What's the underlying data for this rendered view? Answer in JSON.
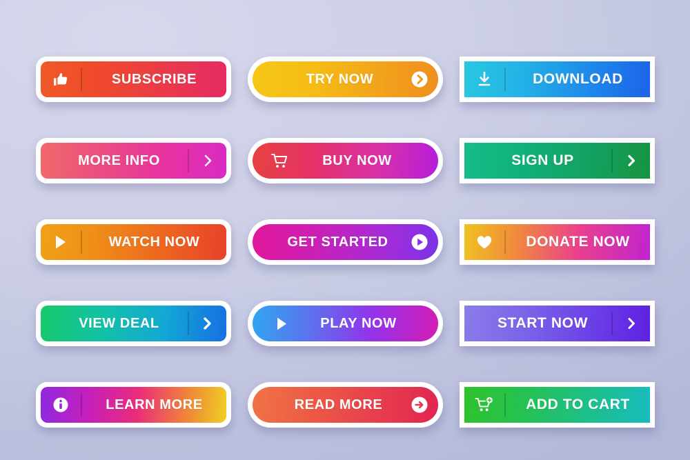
{
  "page": {
    "title": "Gradient Call-To-Action Button Set",
    "background_colors": [
      "#d6d8ec",
      "#b3b8d8"
    ],
    "columns": 3,
    "rows": 5,
    "button_count": 15
  },
  "buttons": [
    {
      "id": "subscribe",
      "label": "SUBSCRIBE",
      "shape": "rounded-rect",
      "icon": "thumbs-up-icon",
      "icon_position": "left",
      "divider": true,
      "gradient": [
        "#f05a28",
        "#e52a63"
      ]
    },
    {
      "id": "try-now",
      "label": "TRY NOW",
      "shape": "pill",
      "icon": "chevron-right-circle-icon",
      "icon_position": "right",
      "divider": false,
      "gradient": [
        "#f6c717",
        "#ef8f1f"
      ]
    },
    {
      "id": "download",
      "label": "DOWNLOAD",
      "shape": "square",
      "icon": "download-arrow-icon",
      "icon_position": "left",
      "divider": true,
      "gradient": [
        "#2ac7e0",
        "#1b63e8"
      ]
    },
    {
      "id": "more-info",
      "label": "MORE INFO",
      "shape": "rounded-rect",
      "icon": "chevron-right-icon",
      "icon_position": "right",
      "divider": true,
      "gradient": [
        "#ef6a6a",
        "#d92bc4"
      ]
    },
    {
      "id": "buy-now",
      "label": "BUY NOW",
      "shape": "pill",
      "icon": "shopping-cart-icon",
      "icon_position": "left",
      "divider": false,
      "gradient": [
        "#e8413f",
        "#b41ddb"
      ]
    },
    {
      "id": "sign-up",
      "label": "SIGN UP",
      "shape": "square",
      "icon": "chevron-right-icon",
      "icon_position": "right",
      "divider": true,
      "gradient": [
        "#14bd89",
        "#17943f"
      ]
    },
    {
      "id": "watch-now",
      "label": "WATCH NOW",
      "shape": "rounded-rect",
      "icon": "play-triangle-icon",
      "icon_position": "left",
      "divider": true,
      "gradient": [
        "#f0a118",
        "#e8412a"
      ]
    },
    {
      "id": "get-started",
      "label": "GET STARTED",
      "shape": "pill",
      "icon": "play-circle-icon",
      "icon_position": "right",
      "divider": false,
      "gradient": [
        "#e0189b",
        "#7a34e8"
      ]
    },
    {
      "id": "donate-now",
      "label": "DONATE NOW",
      "shape": "square",
      "icon": "heart-icon",
      "icon_position": "left",
      "divider": true,
      "gradient": [
        "#f0c222",
        "#c024cf"
      ]
    },
    {
      "id": "view-deal",
      "label": "VIEW DEAL",
      "shape": "rounded-rect",
      "icon": "chevron-right-icon",
      "icon_position": "right",
      "divider": true,
      "gradient": [
        "#17c96a",
        "#1670e2"
      ]
    },
    {
      "id": "play-now",
      "label": "PLAY NOW",
      "shape": "pill",
      "icon": "play-triangle-icon",
      "icon_position": "left",
      "divider": false,
      "gradient": [
        "#2fa6f0",
        "#d41cb4"
      ]
    },
    {
      "id": "start-now",
      "label": "START NOW",
      "shape": "square",
      "icon": "chevron-right-icon",
      "icon_position": "right",
      "divider": true,
      "gradient": [
        "#8a7ceb",
        "#5f21e0"
      ]
    },
    {
      "id": "learn-more",
      "label": "LEARN MORE",
      "shape": "rounded-rect",
      "icon": "info-circle-icon",
      "icon_position": "left",
      "divider": true,
      "gradient": [
        "#8e29e0",
        "#f0cf22"
      ]
    },
    {
      "id": "read-more",
      "label": "READ MORE",
      "shape": "pill",
      "icon": "arrow-right-circle-icon",
      "icon_position": "right",
      "divider": false,
      "gradient": [
        "#ef7445",
        "#e12552"
      ]
    },
    {
      "id": "add-to-cart",
      "label": "ADD TO CART",
      "shape": "square",
      "icon": "add-to-cart-icon",
      "icon_position": "left",
      "divider": true,
      "gradient": [
        "#2fc32a",
        "#19bcbf"
      ]
    }
  ]
}
